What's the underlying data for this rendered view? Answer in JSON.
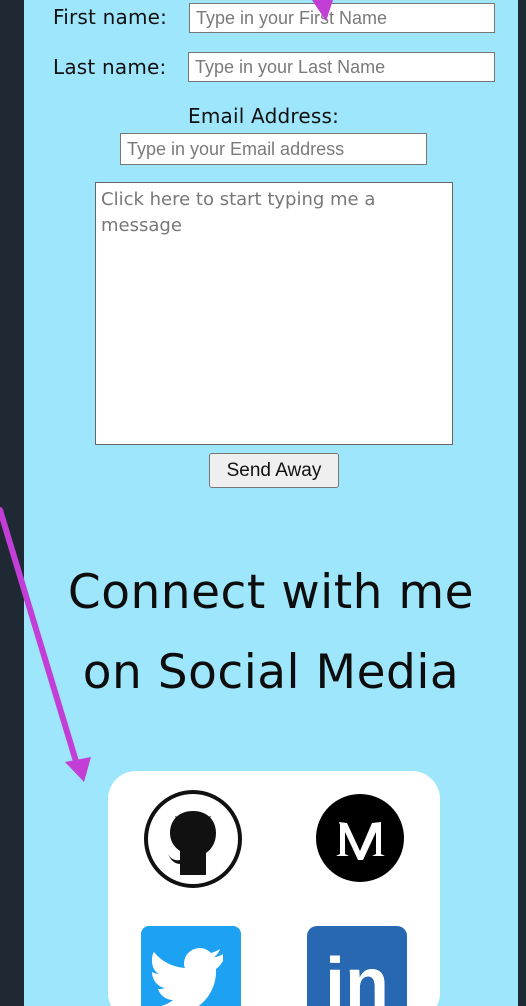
{
  "form": {
    "first_name_label": "First name:",
    "first_name_placeholder": "Type in your First Name",
    "last_name_label": "Last name:",
    "last_name_placeholder": "Type in your Last Name",
    "email_label": "Email Address:",
    "email_placeholder": "Type in your Email address",
    "message_placeholder": "Click here to start typing me a message",
    "send_label": "Send Away"
  },
  "social": {
    "title_line1": "Connect with me",
    "title_line2": "on Social Media",
    "icons": [
      "github-icon",
      "medium-icon",
      "twitter-icon",
      "linkedin-icon"
    ],
    "linkedin_text": "in"
  },
  "colors": {
    "panel_bg": "#9ee6fb",
    "page_bg": "#1f2933",
    "arrow": "#c23ed6",
    "twitter": "#1da1f2",
    "linkedin": "#2867b2"
  }
}
